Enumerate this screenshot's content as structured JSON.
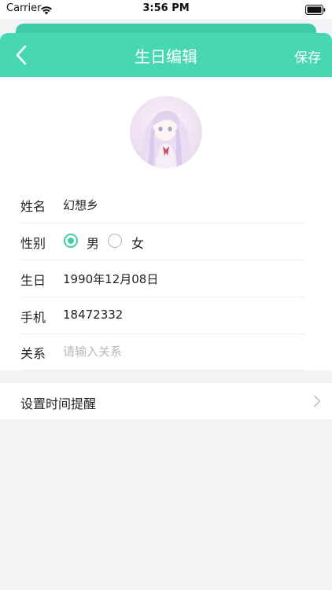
{
  "status_bar": {
    "carrier": "Carrier",
    "time": "3:56 PM"
  },
  "nav": {
    "title": "生日编辑",
    "save_label": "保存",
    "accent_color": "#47d8b3"
  },
  "form": {
    "name": {
      "label": "姓名",
      "value": "幻想乡"
    },
    "gender": {
      "label": "性别",
      "options": [
        {
          "label": "男",
          "selected": true
        },
        {
          "label": "女",
          "selected": false
        }
      ]
    },
    "birthday": {
      "label": "生日",
      "value": "1990年12月08日"
    },
    "phone": {
      "label": "手机",
      "value": "18472332"
    },
    "relation": {
      "label": "关系",
      "value": "",
      "placeholder": "请输入关系"
    }
  },
  "reminder": {
    "label": "设置时间提醒"
  },
  "icons": {
    "back": "chevron-left-icon",
    "wifi": "wifi-icon",
    "battery": "battery-icon",
    "reminder_arrow": "chevron-right-icon"
  }
}
